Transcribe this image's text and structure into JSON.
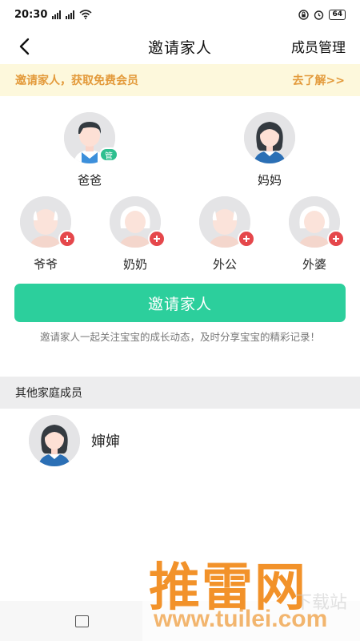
{
  "status_bar": {
    "time": "20:30",
    "net1": "4G",
    "net2": "2G",
    "battery": "64"
  },
  "nav": {
    "title": "邀请家人",
    "action": "成员管理"
  },
  "banner": {
    "text": "邀请家人，获取免费会员",
    "link": "去了解>>"
  },
  "members_main": [
    {
      "label": "爸爸",
      "badge": "管"
    },
    {
      "label": "妈妈"
    }
  ],
  "members_grand": [
    {
      "label": "爷爷"
    },
    {
      "label": "奶奶"
    },
    {
      "label": "外公"
    },
    {
      "label": "外婆"
    }
  ],
  "invite": {
    "button_label": "邀请家人",
    "hint": "邀请家人一起关注宝宝的成长动态，及时分享宝宝的精彩记录！"
  },
  "other_section": {
    "title": "其他家庭成员",
    "members": [
      {
        "name": "婶婶"
      }
    ]
  },
  "watermark": {
    "title": "推雷网",
    "url": "www.tuilei.com",
    "faint": "下载站"
  },
  "colors": {
    "accent": "#2ccf9c",
    "banner_text": "#e39a3b",
    "add_badge": "#e5474b",
    "admin_badge": "#2ebf8f"
  },
  "icons": [
    "back-arrow-icon",
    "plus-icon",
    "signal-icon",
    "wifi-icon",
    "alarm-icon",
    "battery-icon",
    "recent-apps-icon"
  ]
}
